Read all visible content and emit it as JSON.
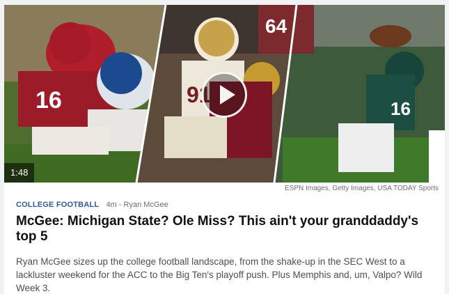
{
  "video": {
    "duration": "1:48",
    "photo_credit": "ESPN Images, Getty Images, USA TODAY Sports",
    "play_icon": "play-icon"
  },
  "player_numbers": {
    "alabama": "16",
    "florida_state": "91",
    "boston_college_back": "64",
    "michigan_state": "16"
  },
  "article": {
    "category": "COLLEGE FOOTBALL",
    "time_ago": "4m",
    "author_prefix": "-",
    "author": "Ryan McGee",
    "headline": "McGee: Michigan State? Ole Miss? This ain't your granddaddy's top 5",
    "summary": "Ryan McGee sizes up the college football landscape, from the shake-up in the SEC West to a lackluster weekend for the ACC to the Big Ten's playoff push. Plus Memphis and, um, Valpo? Wild Week 3."
  }
}
